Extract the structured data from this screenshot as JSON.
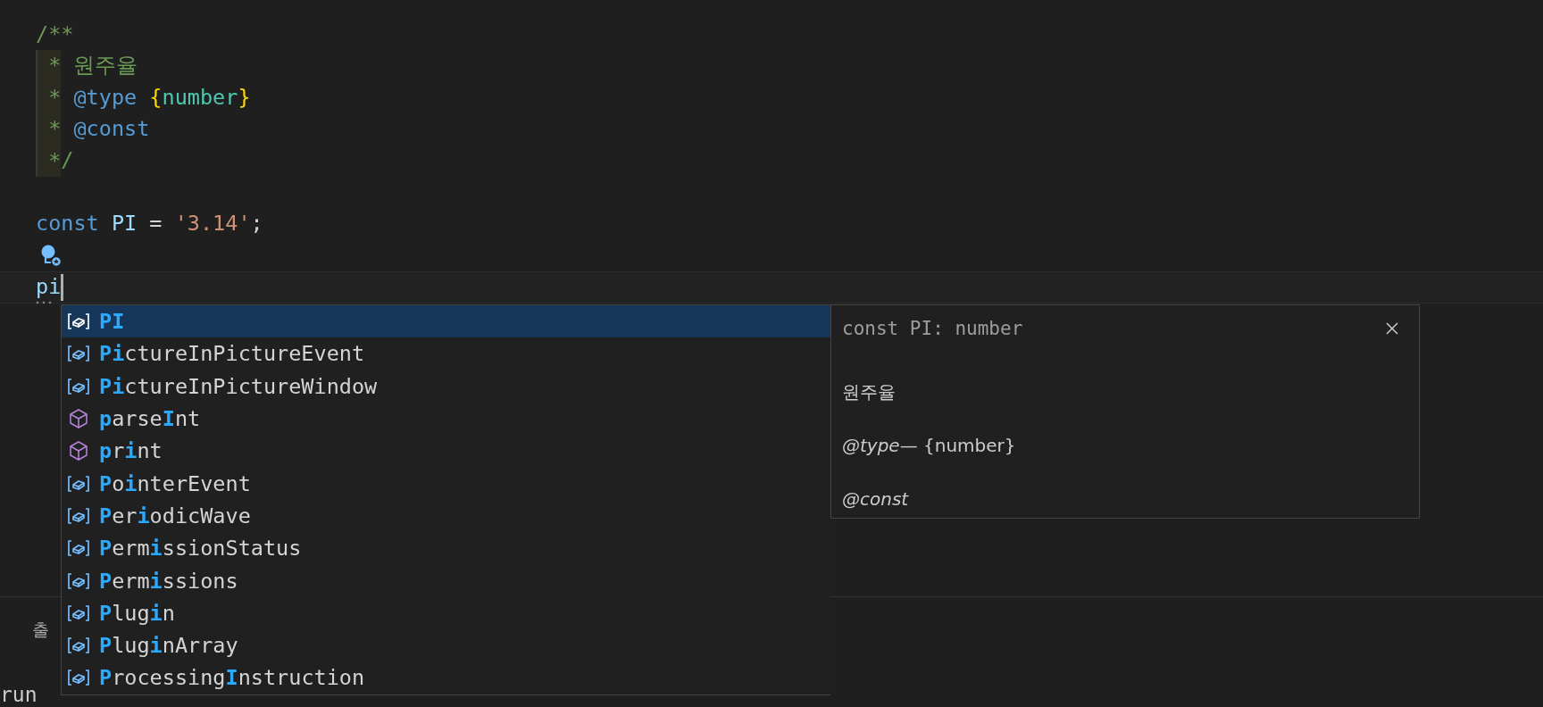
{
  "editor": {
    "lines": [
      {
        "kind": "code",
        "highlighted": false,
        "tokens": [
          {
            "text": "/**",
            "kind": "comment"
          }
        ]
      },
      {
        "kind": "code",
        "highlighted": true,
        "tokens": [
          {
            "text": " *",
            "kind": "comment"
          },
          {
            "text": " 원주율",
            "kind": "comment"
          }
        ]
      },
      {
        "kind": "code",
        "highlighted": true,
        "tokens": [
          {
            "text": " *",
            "kind": "comment"
          },
          {
            "text": " @type",
            "kind": "tag"
          },
          {
            "text": " {",
            "kind": "brace"
          },
          {
            "text": "number",
            "kind": "type"
          },
          {
            "text": "}",
            "kind": "brace"
          }
        ]
      },
      {
        "kind": "code",
        "highlighted": true,
        "tokens": [
          {
            "text": " *",
            "kind": "comment"
          },
          {
            "text": " @const",
            "kind": "tag"
          }
        ]
      },
      {
        "kind": "code",
        "highlighted": true,
        "tokens": [
          {
            "text": " *",
            "kind": "comment"
          },
          {
            "text": "/",
            "kind": "comment"
          }
        ]
      },
      {
        "kind": "blank"
      },
      {
        "kind": "code",
        "highlighted": false,
        "tokens": [
          {
            "text": "const",
            "kind": "keyword"
          },
          {
            "text": " PI",
            "kind": "variable"
          },
          {
            "text": " =",
            "kind": "operator"
          },
          {
            "text": " '3.14'",
            "kind": "string"
          },
          {
            "text": ";",
            "kind": "operator"
          }
        ]
      },
      {
        "kind": "lightbulb"
      },
      {
        "kind": "current",
        "highlighted": false,
        "tokens": [
          {
            "text": "pi",
            "kind": "variable"
          }
        ]
      }
    ]
  },
  "suggestions": {
    "items": [
      {
        "kind": "variable",
        "selected": true,
        "parts": [
          {
            "text": "PI",
            "match": true
          }
        ]
      },
      {
        "kind": "variable",
        "selected": false,
        "parts": [
          {
            "text": "Pi",
            "match": true
          },
          {
            "text": "ctureInPictureEvent",
            "match": false
          }
        ]
      },
      {
        "kind": "variable",
        "selected": false,
        "parts": [
          {
            "text": "Pi",
            "match": true
          },
          {
            "text": "ctureInPictureWindow",
            "match": false
          }
        ]
      },
      {
        "kind": "method",
        "selected": false,
        "parts": [
          {
            "text": "p",
            "match": true
          },
          {
            "text": "arse",
            "match": false
          },
          {
            "text": "I",
            "match": true
          },
          {
            "text": "nt",
            "match": false
          }
        ]
      },
      {
        "kind": "method",
        "selected": false,
        "parts": [
          {
            "text": "p",
            "match": true
          },
          {
            "text": "r",
            "match": false
          },
          {
            "text": "i",
            "match": true
          },
          {
            "text": "nt",
            "match": false
          }
        ]
      },
      {
        "kind": "variable",
        "selected": false,
        "parts": [
          {
            "text": "P",
            "match": true
          },
          {
            "text": "o",
            "match": false
          },
          {
            "text": "i",
            "match": true
          },
          {
            "text": "nterEvent",
            "match": false
          }
        ]
      },
      {
        "kind": "variable",
        "selected": false,
        "parts": [
          {
            "text": "P",
            "match": true
          },
          {
            "text": "er",
            "match": false
          },
          {
            "text": "i",
            "match": true
          },
          {
            "text": "odicWave",
            "match": false
          }
        ]
      },
      {
        "kind": "variable",
        "selected": false,
        "parts": [
          {
            "text": "P",
            "match": true
          },
          {
            "text": "erm",
            "match": false
          },
          {
            "text": "i",
            "match": true
          },
          {
            "text": "ssionStatus",
            "match": false
          }
        ]
      },
      {
        "kind": "variable",
        "selected": false,
        "parts": [
          {
            "text": "P",
            "match": true
          },
          {
            "text": "erm",
            "match": false
          },
          {
            "text": "i",
            "match": true
          },
          {
            "text": "ssions",
            "match": false
          }
        ]
      },
      {
        "kind": "variable",
        "selected": false,
        "parts": [
          {
            "text": "P",
            "match": true
          },
          {
            "text": "lug",
            "match": false
          },
          {
            "text": "i",
            "match": true
          },
          {
            "text": "n",
            "match": false
          }
        ]
      },
      {
        "kind": "variable",
        "selected": false,
        "parts": [
          {
            "text": "P",
            "match": true
          },
          {
            "text": "lug",
            "match": false
          },
          {
            "text": "i",
            "match": true
          },
          {
            "text": "nArray",
            "match": false
          }
        ]
      },
      {
        "kind": "variable",
        "selected": false,
        "parts": [
          {
            "text": "P",
            "match": true
          },
          {
            "text": "rocessing",
            "match": false
          },
          {
            "text": "I",
            "match": true
          },
          {
            "text": "nstruction",
            "match": false
          }
        ]
      }
    ]
  },
  "details": {
    "signature": "const PI: number",
    "description": "원주율",
    "tags": [
      {
        "name": "@type",
        "text": "— {number}"
      },
      {
        "name": "@const"
      }
    ]
  },
  "panel": {
    "tab": "출",
    "terminal": "run"
  }
}
